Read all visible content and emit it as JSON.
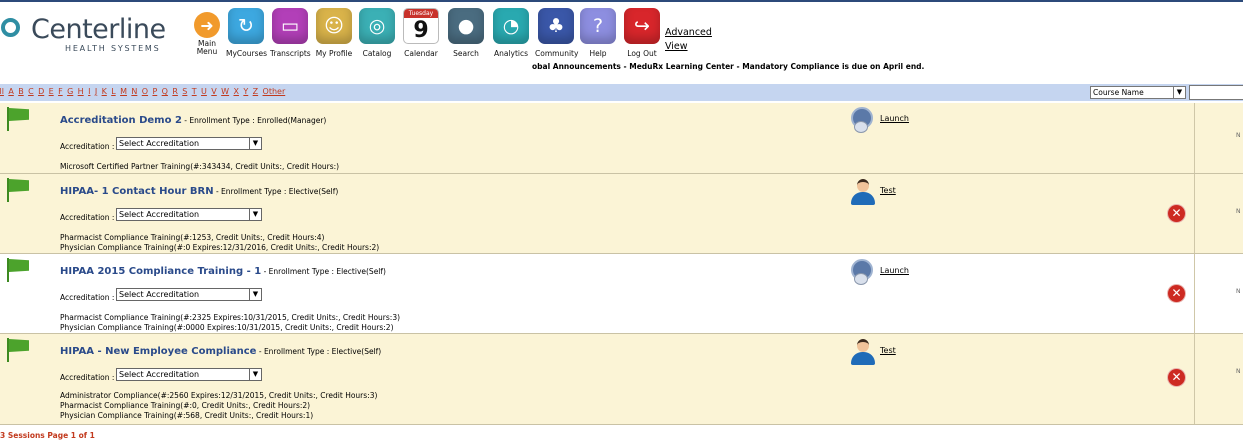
{
  "logo": {
    "name": "Centerline",
    "sub": "HEALTH SYSTEMS"
  },
  "nav": {
    "main_menu": "Main Menu",
    "items": [
      {
        "label": "MyCourses",
        "icon": "mycourses-icon",
        "color": "#3da8e0"
      },
      {
        "label": "Transcripts",
        "icon": "transcripts-icon",
        "color": "#b23fb8"
      },
      {
        "label": "My Profile",
        "icon": "profile-icon",
        "color": "#d9b34a"
      },
      {
        "label": "Catalog",
        "icon": "catalog-icon",
        "color": "#3bb0b5"
      },
      {
        "label": "Calendar",
        "icon": "calendar-icon",
        "color": "#ffffff"
      },
      {
        "label": "Search",
        "icon": "search-icon",
        "color": "#4a6c80"
      },
      {
        "label": "Analytics",
        "icon": "analytics-icon",
        "color": "#29a9b0"
      },
      {
        "label": "Community",
        "icon": "community-icon",
        "color": "#3a57a8"
      },
      {
        "label": "Help",
        "icon": "help-icon",
        "color": "#8d8ee0"
      },
      {
        "label": "Log Out",
        "icon": "logout-icon",
        "color": "#d8262b"
      }
    ],
    "calendar_weekday": "Tuesday",
    "calendar_day": "9",
    "advanced_view_line1": "Advanced",
    "advanced_view_line2": "View"
  },
  "announcement": "obal Announcements - MeduRx Learning Center - Mandatory Compliance is due on April end.",
  "alpha": {
    "letters": [
      "All",
      "A",
      "B",
      "C",
      "D",
      "E",
      "F",
      "G",
      "H",
      "I",
      "J",
      "K",
      "L",
      "M",
      "N",
      "O",
      "P",
      "Q",
      "R",
      "S",
      "T",
      "U",
      "V",
      "W",
      "X",
      "Y",
      "Z",
      "Other"
    ],
    "sort_value": "Course Name",
    "search_value": ""
  },
  "courses": [
    {
      "title": "Accreditation Demo 2",
      "enrollment": " - Enrollment Type : Enrolled(Manager)",
      "accreditation_label": "Accreditation :",
      "accreditation_value": "Select Accreditation",
      "info": [
        "Microsoft Certified Partner Training(#:343434, Credit Units:, Credit Hours:)"
      ],
      "action": "Launch",
      "action_icon": "launch-icon",
      "deletable": false,
      "shaded": true
    },
    {
      "title": "HIPAA- 1 Contact Hour BRN",
      "enrollment": " - Enrollment Type : Elective(Self)",
      "accreditation_label": "Accreditation :",
      "accreditation_value": "Select Accreditation",
      "info": [
        "Pharmacist Compliance Training(#:1253, Credit Units:, Credit Hours:4)",
        "Physician Compliance Training(#:0 Expires:12/31/2016, Credit Units:, Credit Hours:2)"
      ],
      "action": "Test",
      "action_icon": "person-icon",
      "deletable": true,
      "shaded": true
    },
    {
      "title": "HIPAA 2015 Compliance Training - 1",
      "enrollment": " - Enrollment Type : Elective(Self)",
      "accreditation_label": "Accreditation :",
      "accreditation_value": "Select Accreditation",
      "info": [
        "Pharmacist Compliance Training(#:2325 Expires:10/31/2015, Credit Units:, Credit Hours:3)",
        "Physician Compliance Training(#:0000 Expires:10/31/2015, Credit Units:, Credit Hours:2)"
      ],
      "action": "Launch",
      "action_icon": "launch-icon",
      "deletable": true,
      "shaded": false
    },
    {
      "title": "HIPAA - New Employee Compliance",
      "enrollment": " - Enrollment Type : Elective(Self)",
      "accreditation_label": "Accreditation :",
      "accreditation_value": "Select Accreditation",
      "info": [
        "Administrator Compliance(#:2560 Expires:12/31/2015, Credit Units:, Credit Hours:3)",
        "Pharmacist Compliance Training(#:0, Credit Units:, Credit Hours:2)",
        "Physician Compliance Training(#:568, Credit Units:, Credit Hours:1)"
      ],
      "action": "Test",
      "action_icon": "person-icon",
      "deletable": true,
      "shaded": true
    }
  ],
  "right_col_marker": "N",
  "delete_glyph": "✕",
  "footer": "3 Sessions Page 1 of 1"
}
